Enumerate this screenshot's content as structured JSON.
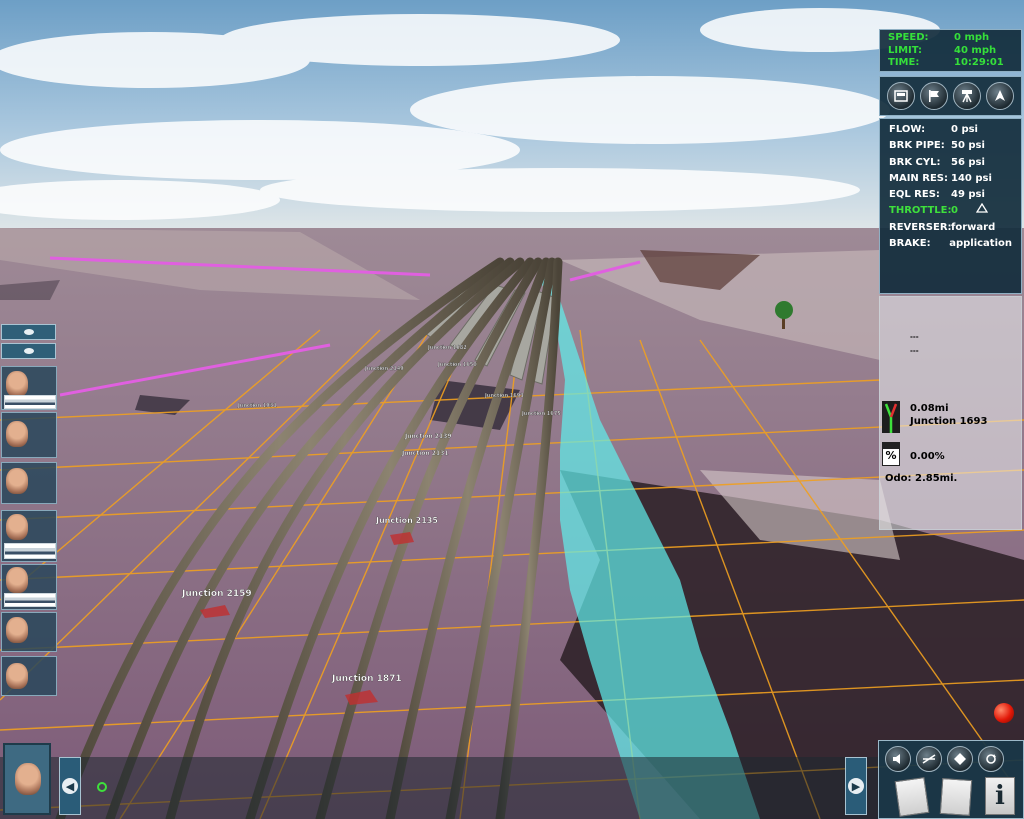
{
  "hud": {
    "speed_label": "SPEED:",
    "speed_value": "0 mph",
    "limit_label": "LIMIT:",
    "limit_value": "40 mph",
    "time_label": "TIME:",
    "time_value": "10:29:01"
  },
  "camera_buttons": [
    "cab-view-icon",
    "flag-icon",
    "tripod-camera-icon",
    "compass-icon"
  ],
  "train_info": {
    "flow_label": "FLOW:",
    "flow_value": "0 psi",
    "brk_pipe_label": "BRK PIPE:",
    "brk_pipe_value": "50 psi",
    "brk_cyl_label": "BRK CYL:",
    "brk_cyl_value": "56 psi",
    "main_res_label": "MAIN RES:",
    "main_res_value": "140 psi",
    "eql_res_label": "EQL RES:",
    "eql_res_value": "49 psi",
    "throttle_label": "THROTTLE:",
    "throttle_value": "0",
    "reverser_label": "REVERSER:",
    "reverser_value": "forward",
    "brake_label": "BRAKE:",
    "brake_value": "application"
  },
  "track_info": {
    "dash1": "---",
    "dash2": "---",
    "next_distance": "0.08mi",
    "next_junction": "Junction 1693",
    "grade": "0.00%",
    "grade_symbol": "%",
    "odometer": "Odo: 2.85mi."
  },
  "junctions": {
    "j2159": "Junction 2159",
    "j1871": "Junction 1871",
    "j2135": "Junction 2135",
    "j2139": "Junction 2139",
    "j2131": "Junction 2131",
    "jfar1": "Junction 1931",
    "jfar2": "Junction 1693",
    "jfar3": "Junction 1675",
    "jfar4": "Junction 2149",
    "jfar5": "Junction 1650",
    "jfar6": "Junction 1682"
  },
  "bottom_controls": {
    "left_arrow": "◀",
    "right_arrow": "▶"
  },
  "colors": {
    "hud_green": "#35e03a",
    "panel_bg": "#122c3c",
    "terrain_purple": "#7e5f7c",
    "grid_orange": "#f0a020",
    "water_cyan": "#5ff0ec",
    "signal_red": "#e21808"
  }
}
